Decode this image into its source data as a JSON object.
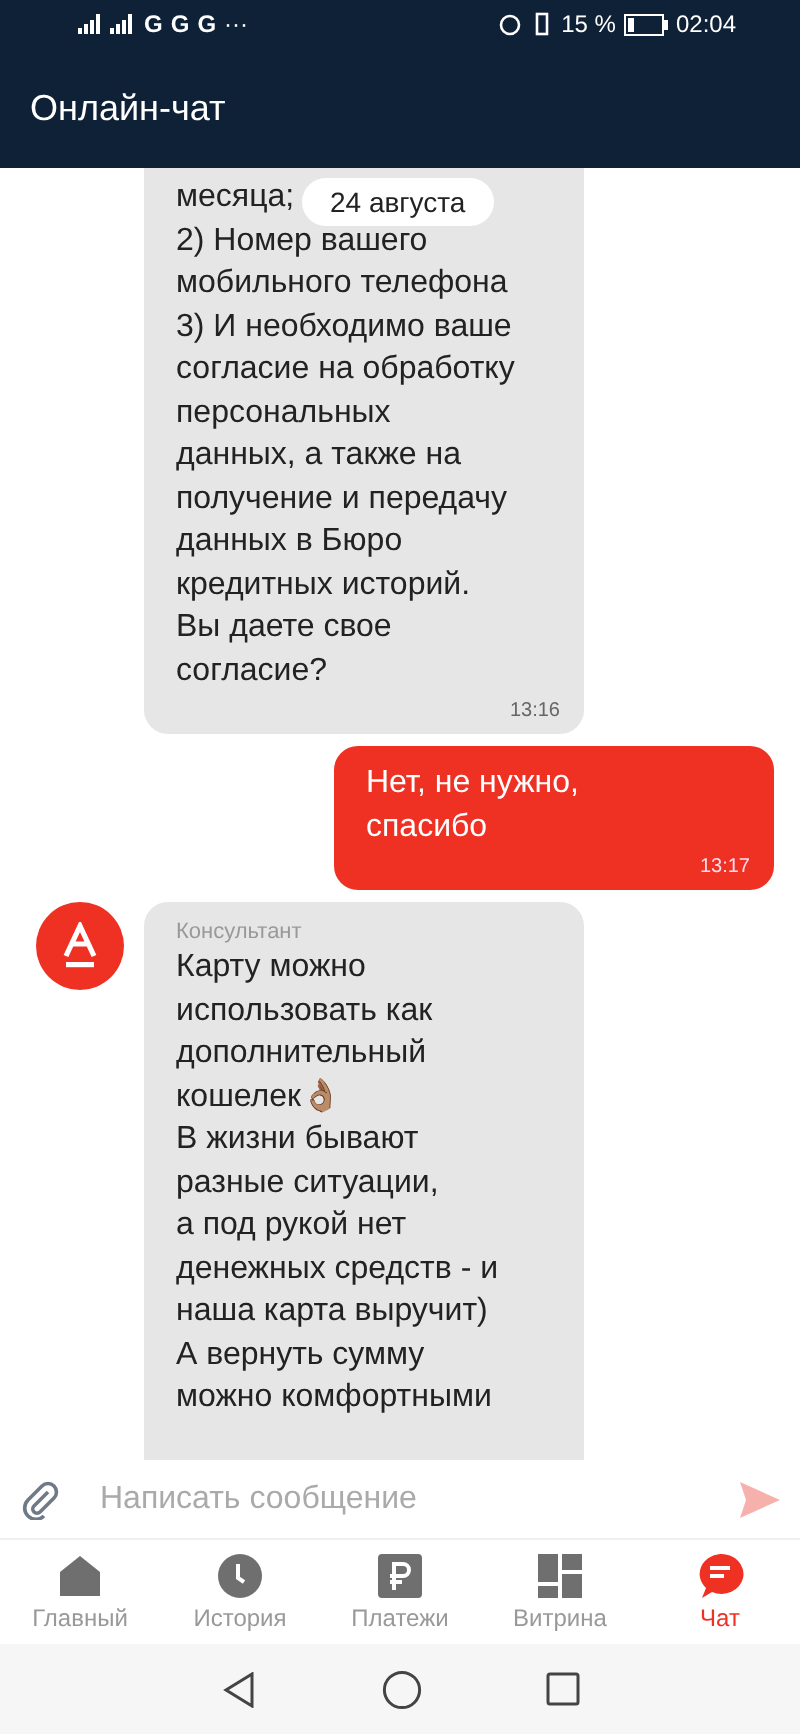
{
  "status_bar": {
    "network_letters": [
      "G",
      "G",
      "G"
    ],
    "more": "···",
    "battery": "15 %",
    "time": "02:04"
  },
  "header": {
    "title": "Онлайн-чат"
  },
  "date_chip": "24 августа",
  "messages": [
    {
      "kind": "incoming",
      "avatar": false,
      "lines": [
        "месяца;",
        "2) Номер вашего",
        "мобильного телефона",
        "3) И необходимо ваше",
        "согласие на обработку",
        "персональных",
        "данных, а также на",
        "получение и передачу",
        "данных в Бюро",
        "кредитных историй.",
        "Вы даете свое",
        "согласие?"
      ],
      "time": "13:16"
    },
    {
      "kind": "outgoing",
      "avatar": false,
      "lines": [
        "Нет, не нужно,",
        "спасибо"
      ],
      "time": "13:17"
    },
    {
      "kind": "incoming",
      "avatar": true,
      "sender": "Консультант",
      "lines": [
        "Карту можно",
        "использовать как",
        "дополнительный",
        "кошелек👌🏽",
        "В жизни бывают",
        "разные ситуации,",
        "а под рукой нет",
        "денежных средств - и",
        "наша карта выручит)",
        "А вернуть сумму",
        "можно комфортными"
      ]
    }
  ],
  "composer": {
    "placeholder": "Написать сообщение"
  },
  "nav": [
    {
      "label": "Главный",
      "selected": false
    },
    {
      "label": "История",
      "selected": false
    },
    {
      "label": "Платежи",
      "selected": false
    },
    {
      "label": "Витрина",
      "selected": false
    },
    {
      "label": "Чат",
      "selected": true
    }
  ]
}
